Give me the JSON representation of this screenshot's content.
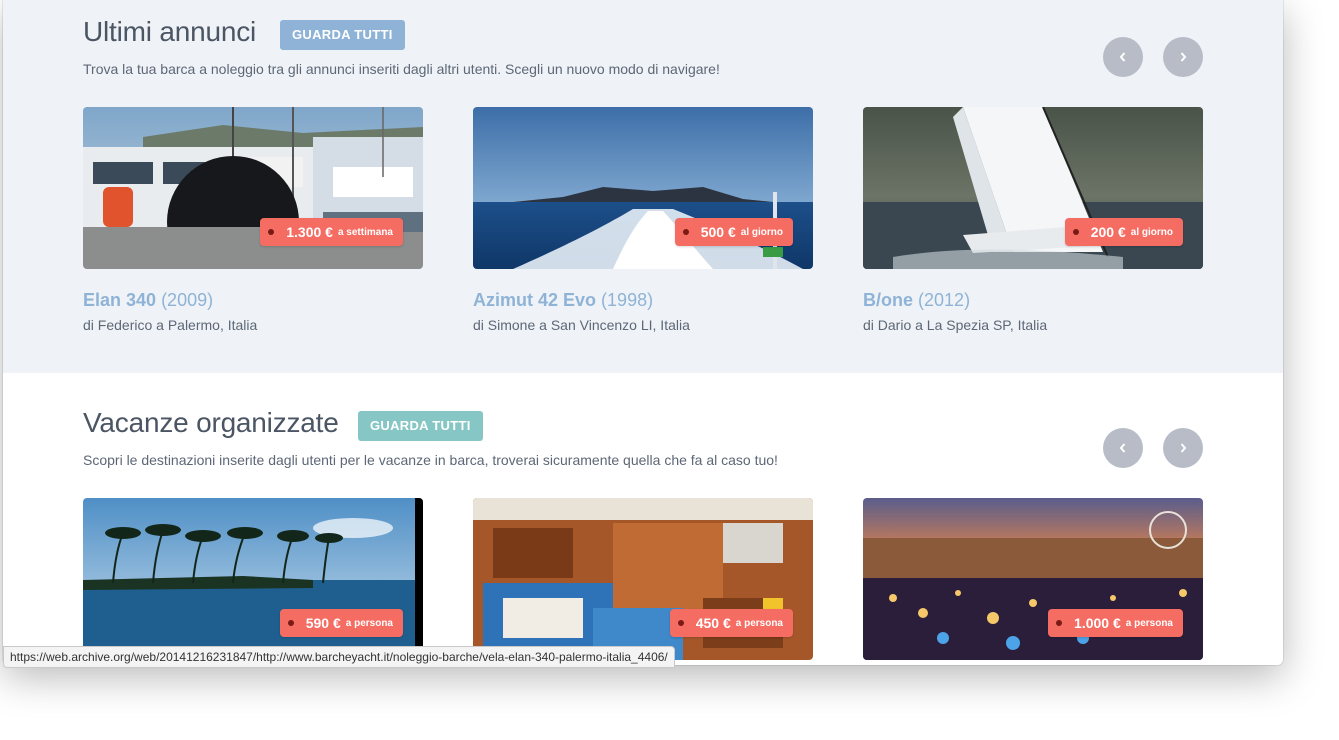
{
  "listings": {
    "title": "Ultimi annunci",
    "see_all": "GUARDA TUTTI",
    "subtitle": "Trova la tua barca a noleggio tra gli annunci inseriti dagli altri utenti. Scegli un nuovo modo di navigare!",
    "prev_icon": "chevron-left-icon",
    "next_icon": "chevron-right-icon",
    "cards": [
      {
        "price": "1.300 €",
        "unit": "a settimana",
        "name": "Elan 340",
        "year": "(2009)",
        "owner": "di Federico a Palermo, Italia"
      },
      {
        "price": "500 €",
        "unit": "al giorno",
        "name": "Azimut 42 Evo",
        "year": "(1998)",
        "owner": "di Simone a San Vincenzo LI, Italia"
      },
      {
        "price": "200 €",
        "unit": "al giorno",
        "name": "B/one",
        "year": "(2012)",
        "owner": "di Dario a La Spezia SP, Italia"
      }
    ]
  },
  "holidays": {
    "title": "Vacanze organizzate",
    "see_all": "GUARDA TUTTI",
    "subtitle": "Scopri le destinazioni inserite dagli utenti per le vacanze in barca, troverai sicuramente quella che fa al caso tuo!",
    "prev_icon": "chevron-left-icon",
    "next_icon": "chevron-right-icon",
    "cards": [
      {
        "price": "590 €",
        "unit": "a persona"
      },
      {
        "price": "450 €",
        "unit": "a persona"
      },
      {
        "price": "1.000 €",
        "unit": "a persona"
      }
    ]
  },
  "colors": {
    "section_bg": "#eff3f7",
    "listings_badge": "#8fb3d6",
    "holidays_badge": "#86c7c5",
    "price_tag": "#f56c62",
    "card_title": "#8fb3d6",
    "nav_button": "#b7bcc7"
  },
  "status_bar": {
    "url": "https://web.archive.org/web/20141216231847/http://www.barcheyacht.it/noleggio-barche/vela-elan-340-palermo-italia_4406/"
  }
}
